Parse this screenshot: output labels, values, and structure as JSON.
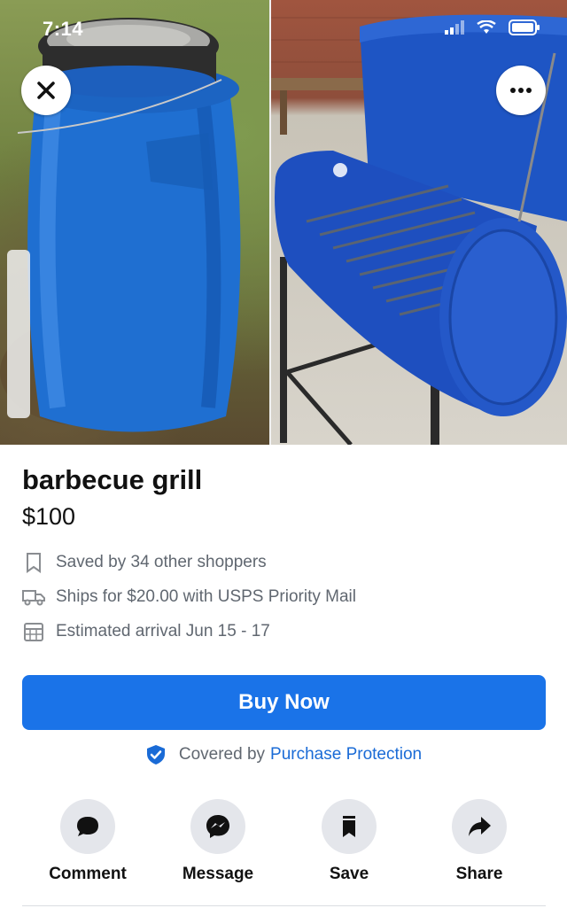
{
  "status_bar": {
    "time": "7:14"
  },
  "listing": {
    "title": "barbecue grill",
    "price": "$100"
  },
  "details": [
    {
      "icon": "bookmark-icon",
      "text": "Saved by 34 other shoppers"
    },
    {
      "icon": "truck-icon",
      "text": "Ships for $20.00 with USPS Priority Mail"
    },
    {
      "icon": "calendar-icon",
      "text": "Estimated arrival Jun 15 - 17"
    }
  ],
  "buy_button": {
    "label": "Buy Now",
    "color": "#1a73e8"
  },
  "protection": {
    "prefix": "Covered by",
    "link": "Purchase Protection",
    "link_color": "#1a6bd6"
  },
  "actions": [
    {
      "label": "Comment",
      "icon": "comment-icon"
    },
    {
      "label": "Message",
      "icon": "messenger-icon"
    },
    {
      "label": "Save",
      "icon": "bookmark-icon"
    },
    {
      "label": "Share",
      "icon": "share-arrow-icon"
    }
  ],
  "photos": [
    {
      "subject": "blue-barrel-photo"
    },
    {
      "subject": "barrel-grill-photo"
    }
  ]
}
